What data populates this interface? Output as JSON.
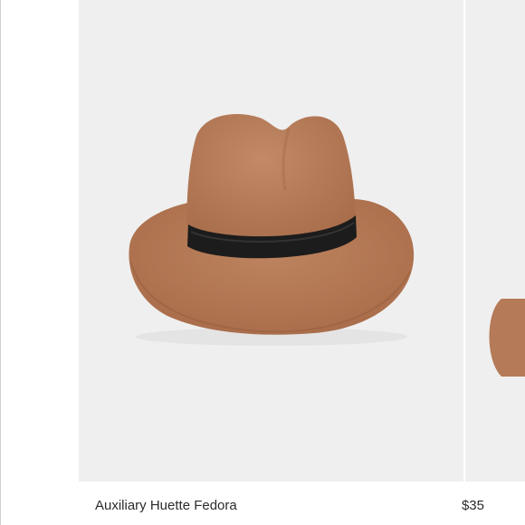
{
  "product": {
    "name": "Auxiliary Huette Fedora",
    "price": "$35",
    "image_alt": "brown felt fedora with black band"
  },
  "colors": {
    "image_bg": "#efefef",
    "felt": "#b57a57",
    "band": "#1c1c1c",
    "text": "#2b2b2b"
  }
}
